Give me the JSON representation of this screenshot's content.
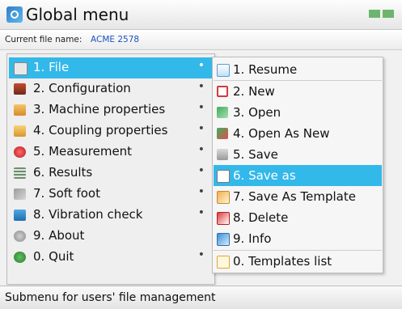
{
  "window": {
    "title": "Global menu",
    "file_label": "Current file name:",
    "file_name": "ACME 2578"
  },
  "menu": {
    "items": [
      {
        "label": "1. File",
        "selected": true,
        "icon": "file-icon"
      },
      {
        "label": "2. Configuration",
        "icon": "configuration-icon"
      },
      {
        "label": "3. Machine properties",
        "icon": "machine-properties-icon"
      },
      {
        "label": "4. Coupling properties",
        "icon": "coupling-properties-icon"
      },
      {
        "label": "5. Measurement",
        "icon": "measurement-icon"
      },
      {
        "label": "6. Results",
        "icon": "results-icon"
      },
      {
        "label": "7. Soft foot",
        "icon": "soft-foot-icon"
      },
      {
        "label": "8. Vibration check",
        "icon": "vibration-check-icon"
      },
      {
        "label": "9. About",
        "icon": "about-icon"
      },
      {
        "label": "0. Quit",
        "icon": "quit-icon"
      }
    ]
  },
  "submenu": {
    "items": [
      {
        "label": "1. Resume",
        "icon": "resume-icon"
      },
      {
        "label": "2. New",
        "icon": "new-file-icon"
      },
      {
        "label": "3. Open",
        "icon": "open-icon"
      },
      {
        "label": "4. Open As New",
        "icon": "open-as-new-icon"
      },
      {
        "label": "5. Save",
        "icon": "save-icon"
      },
      {
        "label": "6. Save as",
        "selected": true,
        "icon": "save-as-icon"
      },
      {
        "label": "7. Save As Template",
        "icon": "save-as-template-icon"
      },
      {
        "label": "8. Delete",
        "icon": "delete-icon"
      },
      {
        "label": "9. Info",
        "icon": "info-icon"
      },
      {
        "label": "0. Templates list",
        "icon": "templates-list-icon"
      }
    ]
  },
  "status": {
    "text": "Submenu for users' file management"
  },
  "colors": {
    "highlight": "#33b8ea",
    "filename": "#1a52c4"
  }
}
